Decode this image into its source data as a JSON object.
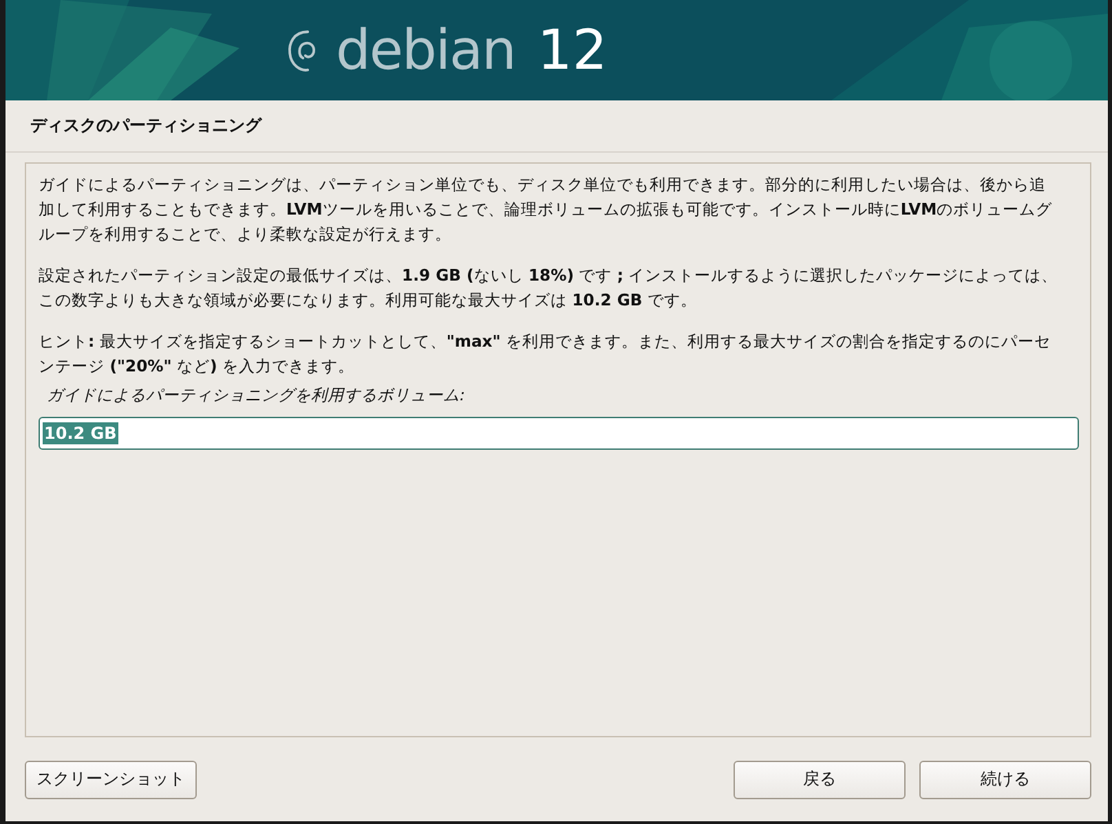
{
  "banner": {
    "name": "debian",
    "version": "12"
  },
  "title": "ディスクのパーティショニング",
  "paragraphs": [
    "ガイドによるパーティショニングは、パーティション単位でも、ディスク単位でも利用できます。部分的に利用したい場合は、後から追加して利用することもできます。**LVM**ツールを用いることで、論理ボリュームの拡張も可能です。インストール時に**LVM**のボリュームグループを利用することで、より柔軟な設定が行えます。",
    "設定されたパーティション設定の最低サイズは、**1.9 GB (**ないし **18%)** です **;** インストールするように選択したパッケージによっては、この数字よりも大きな領域が必要になります。利用可能な最大サイズは **10.2 GB** です。",
    "ヒント**:** 最大サイズを指定するショートカットとして、**\"max\"** を利用できます。また、利用する最大サイズの割合を指定するのにパーセンテージ **(\"20%\"** など**)** を入力できます。"
  ],
  "field": {
    "label": "ガイドによるパーティショニングを利用するボリューム:",
    "value": "10.2 GB",
    "text_selected": true
  },
  "buttons": [
    {
      "label": "スクリーンショット",
      "kind": "left"
    },
    {
      "label": "戻る",
      "kind": "right"
    },
    {
      "label": "続ける",
      "kind": "right"
    }
  ]
}
